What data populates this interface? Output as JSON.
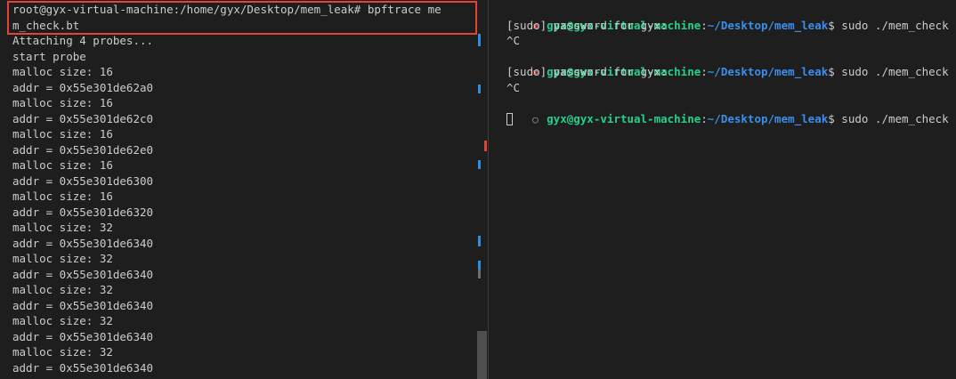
{
  "left_terminal": {
    "command_prompt": "root@gyx-virtual-machine:/home/gyx/Desktop/mem_leak# bpftrace me",
    "command_wrap": "m_check.bt",
    "output_lines": [
      "Attaching 4 probes...",
      "start probe",
      "malloc size: 16",
      "addr = 0x55e301de62a0",
      "malloc size: 16",
      "addr = 0x55e301de62c0",
      "malloc size: 16",
      "addr = 0x55e301de62e0",
      "malloc size: 16",
      "addr = 0x55e301de6300",
      "malloc size: 16",
      "addr = 0x55e301de6320",
      "malloc size: 32",
      "addr = 0x55e301de6340",
      "malloc size: 32",
      "addr = 0x55e301de6340",
      "malloc size: 32",
      "addr = 0x55e301de6340",
      "malloc size: 32",
      "addr = 0x55e301de6340",
      "malloc size: 32",
      "addr = 0x55e301de6340"
    ]
  },
  "right_terminal": {
    "user_host": "gyx@gyx-virtual-machine",
    "path": "~/Desktop/mem_leak",
    "prompt_suffix": "$ sudo ./mem_check",
    "sudo_prompt": "[sudo] password for gyx:",
    "interrupt": "^C",
    "error_marker": "⊗",
    "ok_marker": "○"
  },
  "colors": {
    "background": "#1e1e1e",
    "text": "#cccccc",
    "highlight_box": "#e5433a",
    "user_host": "#23d18b",
    "path": "#3b8eea",
    "error_marker": "#f14c4c"
  }
}
